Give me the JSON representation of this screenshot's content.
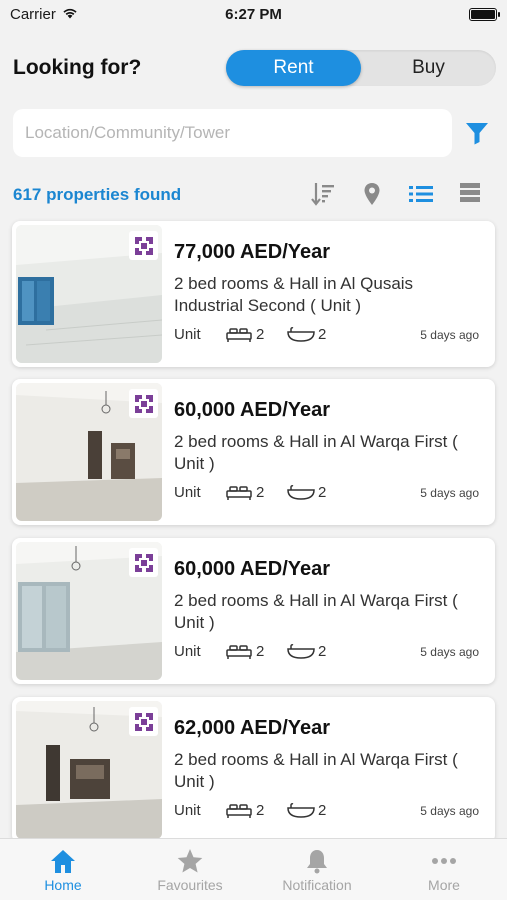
{
  "status": {
    "carrier": "Carrier",
    "time": "6:27 PM"
  },
  "header": {
    "title": "Looking for?",
    "rent_label": "Rent",
    "buy_label": "Buy",
    "selected": "Rent"
  },
  "search": {
    "placeholder": "Location/Community/Tower",
    "value": ""
  },
  "results": {
    "count_text": "617 properties found"
  },
  "toolbar_icons": [
    "sort-icon",
    "map-pin-icon",
    "list-view-icon",
    "compact-list-icon"
  ],
  "colors": {
    "accent": "#1e8fe0",
    "count_text": "#1b86d1",
    "badge": "#7b3f98",
    "tab_inactive": "#a5a5a5"
  },
  "listings": [
    {
      "price": "77,000 AED/Year",
      "title": "2 bed rooms & Hall in Al Qusais Industrial Second ( Unit )",
      "type": "Unit",
      "beds": "2",
      "baths": "2",
      "posted": "5 days ago"
    },
    {
      "price": "60,000 AED/Year",
      "title": "2 bed rooms & Hall in Al Warqa First ( Unit )",
      "type": "Unit",
      "beds": "2",
      "baths": "2",
      "posted": "5 days ago"
    },
    {
      "price": "60,000 AED/Year",
      "title": "2 bed rooms & Hall in Al Warqa First ( Unit )",
      "type": "Unit",
      "beds": "2",
      "baths": "2",
      "posted": "5 days ago"
    },
    {
      "price": "62,000 AED/Year",
      "title": "2 bed rooms & Hall in Al Warqa First ( Unit )",
      "type": "Unit",
      "beds": "2",
      "baths": "2",
      "posted": "5 days ago"
    }
  ],
  "tabs": [
    {
      "label": "Home",
      "icon": "home-icon",
      "active": true
    },
    {
      "label": "Favourites",
      "icon": "star-icon",
      "active": false
    },
    {
      "label": "Notification",
      "icon": "bell-icon",
      "active": false
    },
    {
      "label": "More",
      "icon": "more-icon",
      "active": false
    }
  ]
}
